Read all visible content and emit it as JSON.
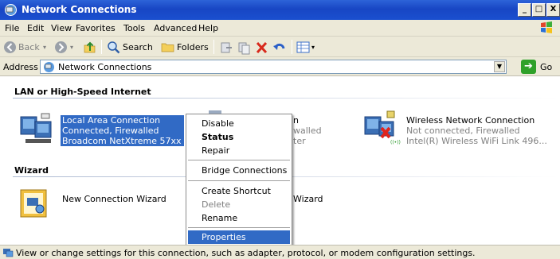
{
  "window": {
    "title": "Network Connections",
    "controls": [
      "_",
      "□",
      "X"
    ]
  },
  "menubar": {
    "items": [
      "File",
      "Edit",
      "View",
      "Favorites",
      "Tools",
      "Advanced",
      "Help"
    ]
  },
  "toolbar": {
    "back_label": "Back",
    "search_label": "Search",
    "folders_label": "Folders"
  },
  "address": {
    "label": "Address",
    "value": "Network Connections",
    "go_label": "Go"
  },
  "groups": {
    "lan_header": "LAN or High-Speed Internet",
    "wizard_header": "Wizard"
  },
  "connections": {
    "local": {
      "line1": "Local Area Connection",
      "line2": "Connected, Firewalled",
      "line3": "Broadcom NetXtreme 57xx Gig..."
    },
    "partial": {
      "line1": "n",
      "line2": "walled",
      "line3": "ter"
    },
    "wireless": {
      "line1": "Wireless Network Connection",
      "line2": "Not connected, Firewalled",
      "line3": "Intel(R) Wireless WiFi Link 496..."
    }
  },
  "wizards": {
    "new_connection": "New Connection Wizard",
    "partial_label": "Wizard"
  },
  "context_menu": {
    "disable": "Disable",
    "status": "Status",
    "repair": "Repair",
    "bridge": "Bridge Connections",
    "shortcut": "Create Shortcut",
    "delete": "Delete",
    "rename": "Rename",
    "properties": "Properties"
  },
  "statusbar": {
    "text": "View or change settings for this connection, such as adapter, protocol, or modem configuration settings."
  },
  "colors": {
    "titlebar": "#1846c4",
    "selection": "#316ac5",
    "chrome": "#ece9d8"
  }
}
